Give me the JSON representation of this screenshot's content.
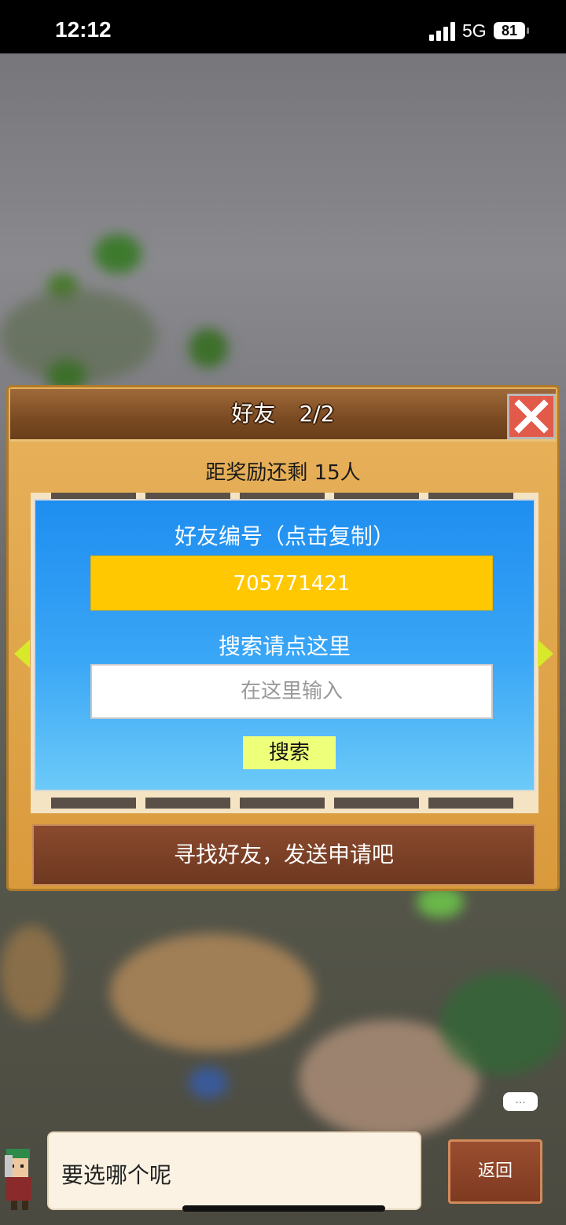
{
  "status_bar": {
    "time": "12:12",
    "network": "5G",
    "battery": "81"
  },
  "dialog": {
    "title": "好友",
    "page": "2/2",
    "reward_text": "距奖励还剩 15人",
    "friend_code_label": "好友编号（点击复制）",
    "friend_code": "705771421",
    "search_hint": "搜索请点这里",
    "search_placeholder": "在这里输入",
    "search_button": "搜索",
    "find_button": "寻找好友，发送申请吧"
  },
  "bottom": {
    "speech": "要选哪个呢",
    "chat_bubble": "...",
    "back_button": "返回"
  },
  "icons": {
    "close": "close-icon",
    "prev": "arrow-left-icon",
    "next": "arrow-right-icon"
  },
  "colors": {
    "friend_code_bg": "#ffc800",
    "search_button_bg": "#eeff7a",
    "close_button_bg": "#e25a4a",
    "panel_blue": "#1e8ef0"
  }
}
